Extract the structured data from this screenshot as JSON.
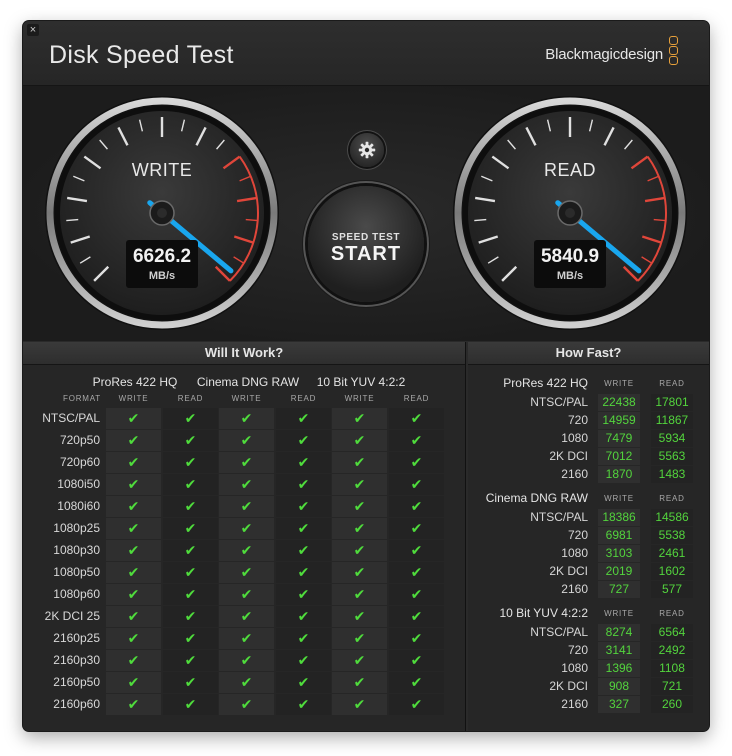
{
  "window": {
    "title": "Disk Speed Test",
    "brand": "Blackmagicdesign",
    "close_glyph": "×"
  },
  "gauges": {
    "write": {
      "label": "WRITE",
      "value": "6626.2",
      "unit": "MB/s"
    },
    "read": {
      "label": "READ",
      "value": "5840.9",
      "unit": "MB/s"
    }
  },
  "start_button": {
    "line1": "SPEED TEST",
    "line2": "START"
  },
  "icons": {
    "settings": "gear-icon",
    "close": "close-icon"
  },
  "colors": {
    "needle": "#19a6ee",
    "check": "#4fdc3c",
    "value": "#53d43d",
    "redline": "#e0463a"
  },
  "will_it_work": {
    "header": "Will It Work?",
    "format_label": "FORMAT",
    "write_label": "WRITE",
    "read_label": "READ",
    "groups": [
      "ProRes 422 HQ",
      "Cinema DNG RAW",
      "10 Bit YUV 4:2:2"
    ],
    "check_glyph": "✔",
    "rows": [
      "NTSC/PAL",
      "720p50",
      "720p60",
      "1080i50",
      "1080i60",
      "1080p25",
      "1080p30",
      "1080p50",
      "1080p60",
      "2K DCI 25",
      "2160p25",
      "2160p30",
      "2160p50",
      "2160p60"
    ]
  },
  "how_fast": {
    "header": "How Fast?",
    "write_label": "WRITE",
    "read_label": "READ",
    "sections": [
      {
        "title": "ProRes 422 HQ",
        "rows": [
          {
            "name": "NTSC/PAL",
            "write": "22438",
            "read": "17801"
          },
          {
            "name": "720",
            "write": "14959",
            "read": "11867"
          },
          {
            "name": "1080",
            "write": "7479",
            "read": "5934"
          },
          {
            "name": "2K DCI",
            "write": "7012",
            "read": "5563"
          },
          {
            "name": "2160",
            "write": "1870",
            "read": "1483"
          }
        ]
      },
      {
        "title": "Cinema DNG RAW",
        "rows": [
          {
            "name": "NTSC/PAL",
            "write": "18386",
            "read": "14586"
          },
          {
            "name": "720",
            "write": "6981",
            "read": "5538"
          },
          {
            "name": "1080",
            "write": "3103",
            "read": "2461"
          },
          {
            "name": "2K DCI",
            "write": "2019",
            "read": "1602"
          },
          {
            "name": "2160",
            "write": "727",
            "read": "577"
          }
        ]
      },
      {
        "title": "10 Bit YUV 4:2:2",
        "rows": [
          {
            "name": "NTSC/PAL",
            "write": "8274",
            "read": "6564"
          },
          {
            "name": "720",
            "write": "3141",
            "read": "2492"
          },
          {
            "name": "1080",
            "write": "1396",
            "read": "1108"
          },
          {
            "name": "2K DCI",
            "write": "908",
            "read": "721"
          },
          {
            "name": "2160",
            "write": "327",
            "read": "260"
          }
        ]
      }
    ]
  }
}
